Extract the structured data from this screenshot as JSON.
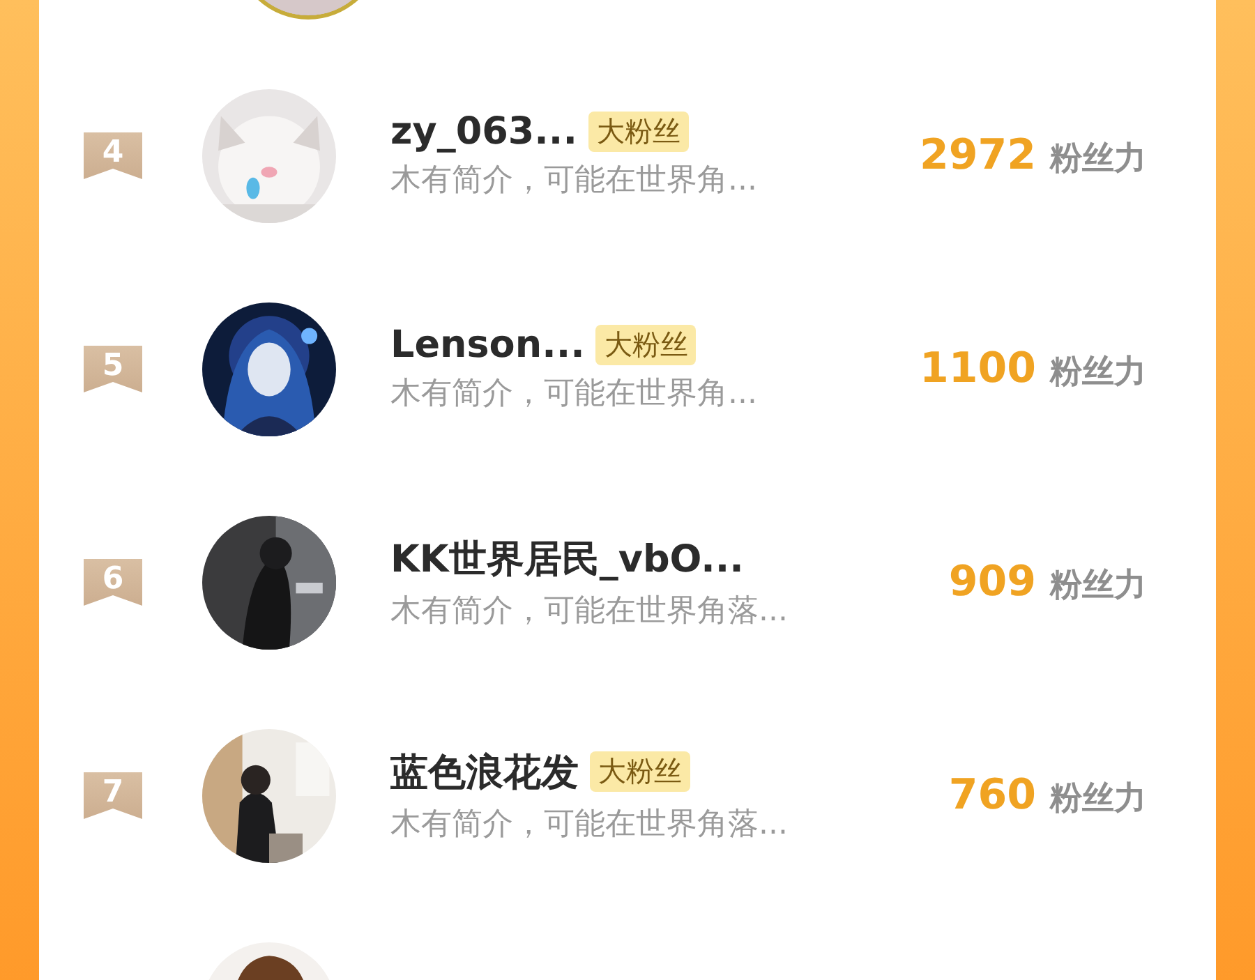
{
  "ranking": [
    {
      "rank": "4",
      "name": "zy_063...",
      "badge": "大粉丝",
      "bio": "木有简介，可能在世界角...",
      "score": "2972",
      "score_label": "粉丝力"
    },
    {
      "rank": "5",
      "name": "Lenson...",
      "badge": "大粉丝",
      "bio": "木有简介，可能在世界角...",
      "score": "1100",
      "score_label": "粉丝力"
    },
    {
      "rank": "6",
      "name": "KK世界居民_vbO...",
      "bio": "木有简介，可能在世界角落...",
      "score": "909",
      "score_label": "粉丝力"
    },
    {
      "rank": "7",
      "name": "蓝色浪花发",
      "badge": "大粉丝",
      "bio": "木有简介，可能在世界角落...",
      "score": "760",
      "score_label": "粉丝力"
    }
  ]
}
